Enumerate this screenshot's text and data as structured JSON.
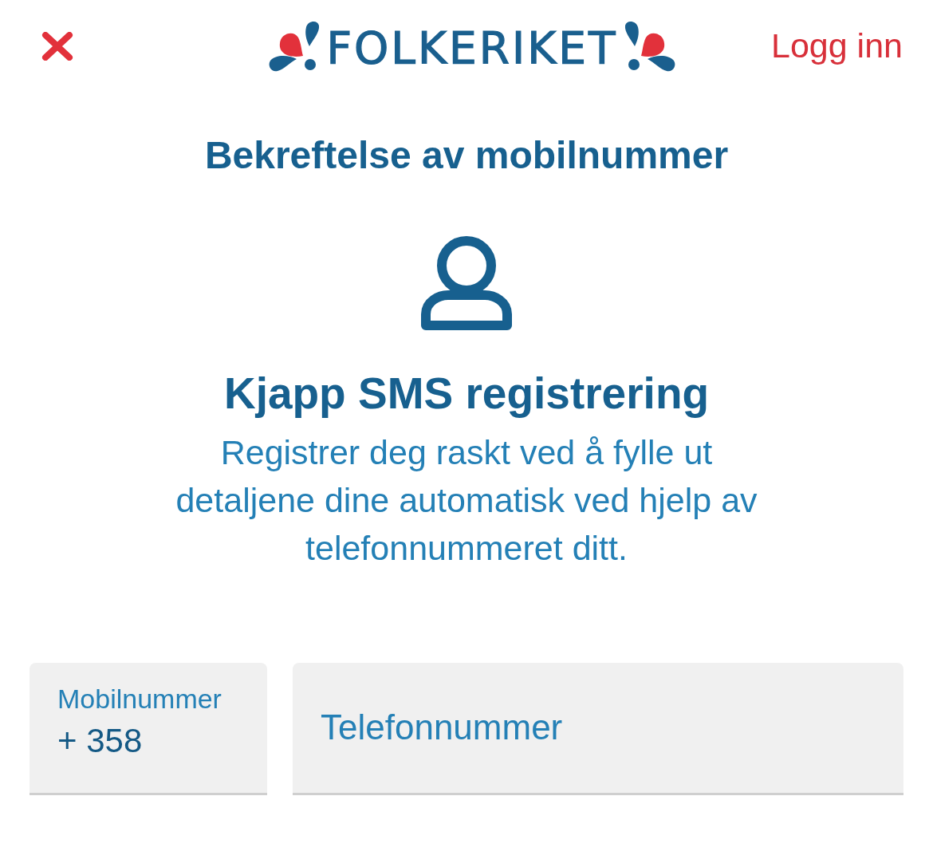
{
  "header": {
    "logo_text": "FOLKERIKET",
    "login_link": "Logg inn"
  },
  "page_title": "Bekreftelse av mobilnummer",
  "intro": {
    "heading": "Kjapp SMS registrering",
    "description": "Registrer deg raskt ved å fylle ut detaljene dine automatisk ved hjelp av telefonnummeret ditt."
  },
  "form": {
    "country_code": {
      "label": "Mobilnummer",
      "value": "+ 358"
    },
    "phone_number": {
      "placeholder": "Telefonnummer"
    }
  }
}
